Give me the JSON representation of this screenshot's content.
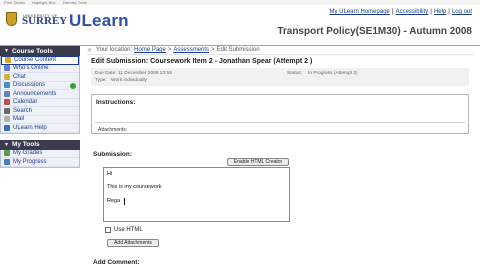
{
  "top_strip": {
    "items": [
      "Print Tables",
      "Highlight Box",
      "Dismiss Tools"
    ]
  },
  "header": {
    "university_small": "UNIVERSITY OF",
    "university_name": "SURREY",
    "app_name": "ULearn",
    "links": [
      "My ULearn Homepage",
      "Accessibility",
      "Help",
      "Log out"
    ],
    "course_title": "Transport Policy(SE1M30) - Autumn 2008"
  },
  "sidebar": {
    "course_tools_title": "Course Tools",
    "course_items": [
      {
        "label": "Course Content",
        "icon": "folder-icon",
        "color": "#d9a429"
      },
      {
        "label": "Who's Online",
        "icon": "people-icon",
        "color": "#5a7fd0"
      },
      {
        "label": "Chat",
        "icon": "chat-icon",
        "color": "#d0b040"
      },
      {
        "label": "Discussions",
        "icon": "discussion-icon",
        "color": "#4a90c8"
      },
      {
        "label": "Announcements",
        "icon": "announcement-icon",
        "color": "#6e7fb8"
      },
      {
        "label": "Calendar",
        "icon": "calendar-icon",
        "color": "#c0504d"
      },
      {
        "label": "Search",
        "icon": "search-icon",
        "color": "#6a6a6a"
      },
      {
        "label": "Mail",
        "icon": "mail-icon",
        "color": "#b0b0b0"
      },
      {
        "label": "ULearn Help",
        "icon": "help-icon",
        "color": "#3a70c0"
      }
    ],
    "my_tools_title": "My Tools",
    "my_items": [
      {
        "label": "My Grades",
        "icon": "grades-icon",
        "color": "#5a9a4a"
      },
      {
        "label": "My Progress",
        "icon": "progress-icon",
        "color": "#4a7ac0"
      }
    ]
  },
  "breadcrumb": {
    "prefix": "Your location:",
    "items": [
      "Home Page",
      "Assessments"
    ],
    "current": "Edit Submission"
  },
  "submission": {
    "heading": "Edit Submission: Coursework Item 2 - Jonathan Spear (Attempt 2 )",
    "due_date_label": "Due Date:",
    "due_date_value": "11 December 2008 23:59",
    "type_label": "Type:",
    "type_value": "Work individually",
    "status_label": "Status:",
    "status_value": "In Progress (Attempt 2)",
    "instructions_title": "Instructions:",
    "attachments_label": "Attachments:",
    "submission_label": "Submission:",
    "enable_html_button": "Enable HTML Creator",
    "editor_lines": [
      "Hi",
      "This is my coursework",
      "Rega"
    ],
    "use_html_label": "Use HTML",
    "add_attachments_button": "Add Attachments",
    "add_comment_label": "Add Comment:"
  }
}
